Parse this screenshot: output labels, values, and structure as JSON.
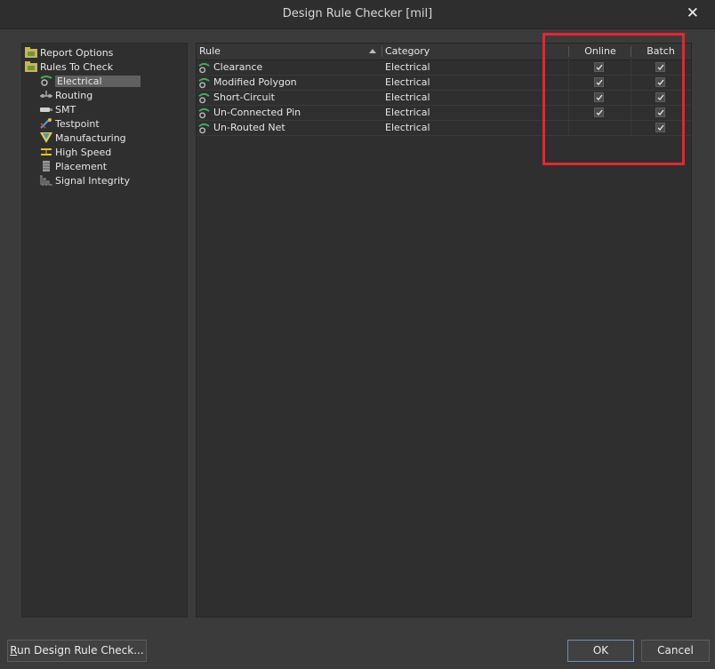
{
  "window": {
    "title": "Design Rule Checker [mil]",
    "close_glyph": "✕"
  },
  "tree": {
    "roots": [
      {
        "label": "Report Options",
        "icon": "folder-icon"
      },
      {
        "label": "Rules To Check",
        "icon": "folder-icon"
      }
    ],
    "children": [
      {
        "label": "Electrical",
        "icon": "electrical-rule-icon",
        "selected": true
      },
      {
        "label": "Routing",
        "icon": "routing-icon"
      },
      {
        "label": "SMT",
        "icon": "smt-icon"
      },
      {
        "label": "Testpoint",
        "icon": "testpoint-icon"
      },
      {
        "label": "Manufacturing",
        "icon": "manufacturing-icon"
      },
      {
        "label": "High Speed",
        "icon": "high-speed-icon"
      },
      {
        "label": "Placement",
        "icon": "placement-icon"
      },
      {
        "label": "Signal Integrity",
        "icon": "signal-integrity-icon"
      }
    ]
  },
  "grid": {
    "columns": {
      "rule": "Rule",
      "category": "Category",
      "online": "Online",
      "batch": "Batch"
    },
    "rows": [
      {
        "rule": "Clearance",
        "category": "Electrical",
        "online": true,
        "batch": true
      },
      {
        "rule": "Modified Polygon",
        "category": "Electrical",
        "online": true,
        "batch": true
      },
      {
        "rule": "Short-Circuit",
        "category": "Electrical",
        "online": true,
        "batch": true
      },
      {
        "rule": "Un-Connected Pin",
        "category": "Electrical",
        "online": true,
        "batch": true
      },
      {
        "rule": "Un-Routed Net",
        "category": "Electrical",
        "online": false,
        "batch": true
      }
    ]
  },
  "buttons": {
    "run": "Run Design Rule Check...",
    "run_accel": "R",
    "run_rest": "un Design Rule Check...",
    "ok": "OK",
    "cancel": "Cancel"
  },
  "colors": {
    "highlight": "#e8252e",
    "background": "#3b3b3b",
    "panel": "#2f2f2f"
  }
}
